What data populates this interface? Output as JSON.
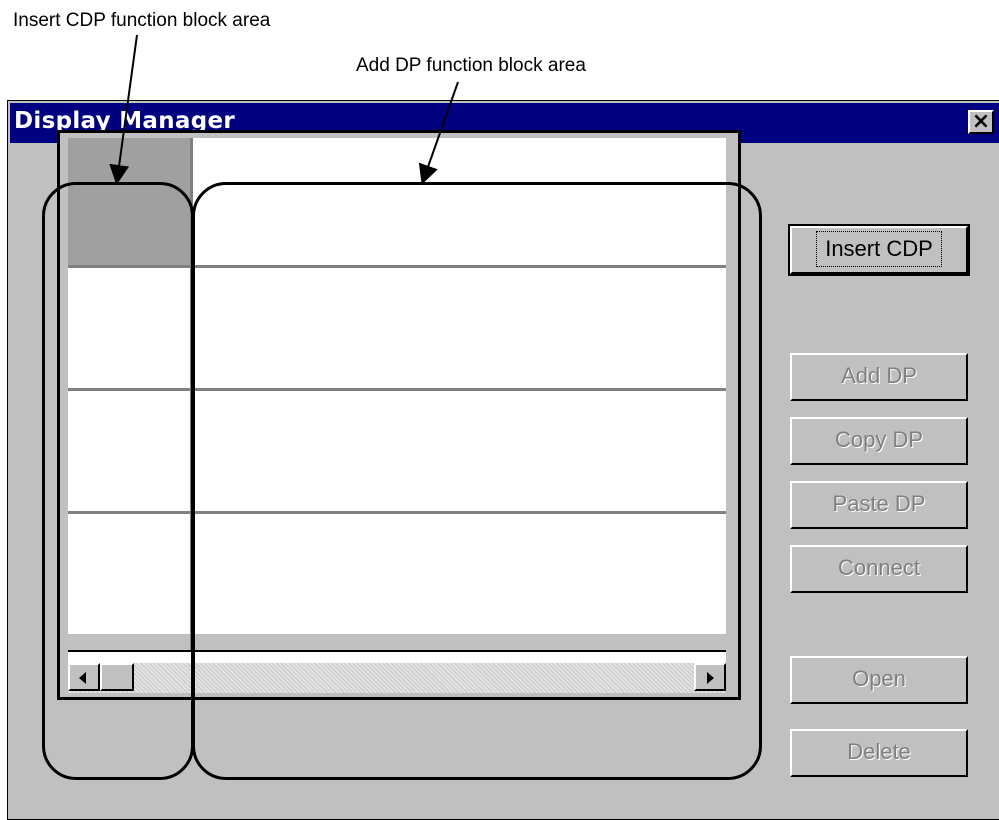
{
  "callouts": {
    "cdp_area": "Insert CDP function block area",
    "dp_area": "Add DP function block area"
  },
  "window": {
    "title": "Display Manager",
    "close_label": "✕"
  },
  "buttons": {
    "insert_cdp": "Insert CDP",
    "add_dp": "Add DP",
    "copy_dp": "Copy DP",
    "paste_dp": "Paste DP",
    "connect": "Connect",
    "open": "Open",
    "delete": "Delete"
  },
  "icons": {
    "scroll_left": "scroll-left-arrow-icon",
    "scroll_right": "scroll-right-arrow-icon",
    "close": "close-icon"
  },
  "colors": {
    "titlebar": "#000080",
    "face": "#c0c0c0",
    "disabled_text": "#808080"
  }
}
